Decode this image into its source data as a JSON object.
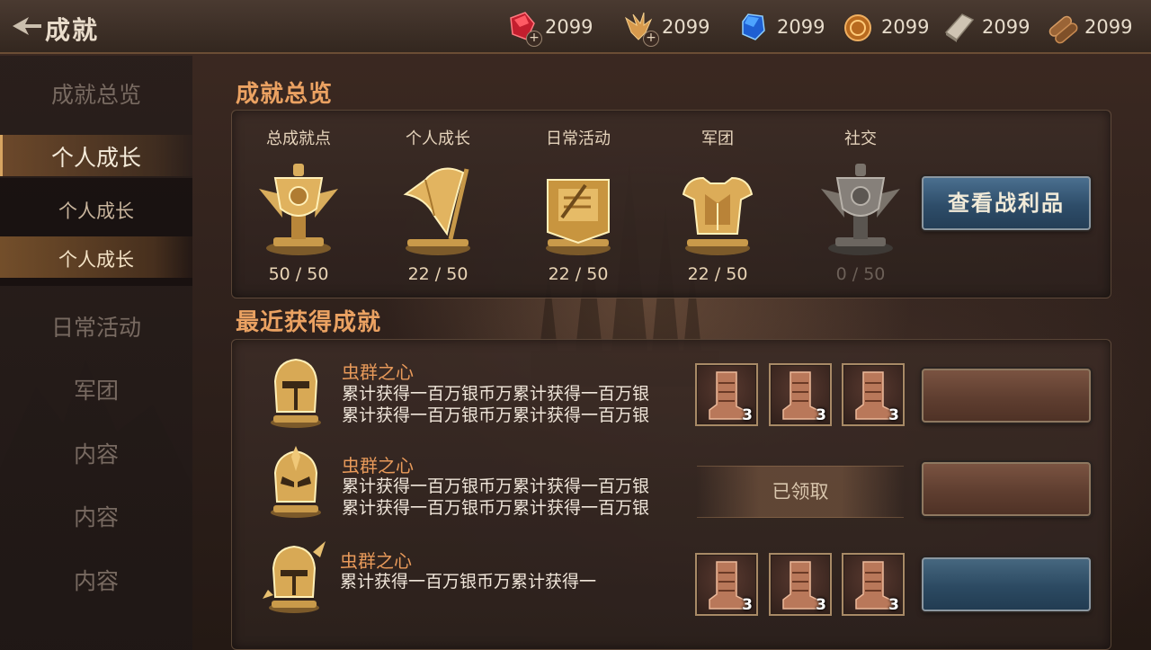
{
  "header": {
    "title": "成就",
    "resources": [
      {
        "icon": "red-gem-icon",
        "value": "2099",
        "has_plus": true
      },
      {
        "icon": "eagle-crest-icon",
        "value": "2099",
        "has_plus": true
      },
      {
        "icon": "blue-crystal-icon",
        "value": "2099",
        "has_plus": false
      },
      {
        "icon": "gold-coin-icon",
        "value": "2099",
        "has_plus": false
      },
      {
        "icon": "stone-block-icon",
        "value": "2099",
        "has_plus": false
      },
      {
        "icon": "wood-log-icon",
        "value": "2099",
        "has_plus": false
      }
    ]
  },
  "sidebar": {
    "items": [
      {
        "label": "成就总览"
      },
      {
        "label": "个人成长"
      },
      {
        "label": "个人成长"
      },
      {
        "label": "个人成长"
      },
      {
        "label": "日常活动"
      },
      {
        "label": "军团"
      },
      {
        "label": "内容"
      },
      {
        "label": "内容"
      },
      {
        "label": "内容"
      }
    ]
  },
  "overview": {
    "title": "成就总览",
    "categories": [
      {
        "label": "总成就点",
        "count": "50 / 50",
        "icon": "trophy-icon"
      },
      {
        "label": "个人成长",
        "count": "22 / 50",
        "icon": "flag-icon"
      },
      {
        "label": "日常活动",
        "count": "22 / 50",
        "icon": "scroll-banner-icon"
      },
      {
        "label": "军团",
        "count": "22 / 50",
        "icon": "armor-icon"
      },
      {
        "label": "社交",
        "count": "0 / 50",
        "icon": "grey-trophy-icon"
      }
    ],
    "loot_button": "查看战利品"
  },
  "recent": {
    "title": "最近获得成就",
    "rows": [
      {
        "name": "虫群之心",
        "desc1": "累计获得一百万银币万累计获得一百万银",
        "desc2": "累计获得一百万银币万累计获得一百万银",
        "rewards": [
          "3",
          "3",
          "3"
        ],
        "button_color": "brown"
      },
      {
        "name": "虫群之心",
        "desc1": "累计获得一百万银币万累计获得一百万银",
        "desc2": "累计获得一百万银币万累计获得一百万银",
        "status": "已领取",
        "button_color": "brown"
      },
      {
        "name": "虫群之心",
        "desc1": "累计获得一百万银币万累计获得一",
        "rewards": [
          "3",
          "3",
          "3"
        ],
        "button_color": "blue"
      }
    ]
  }
}
